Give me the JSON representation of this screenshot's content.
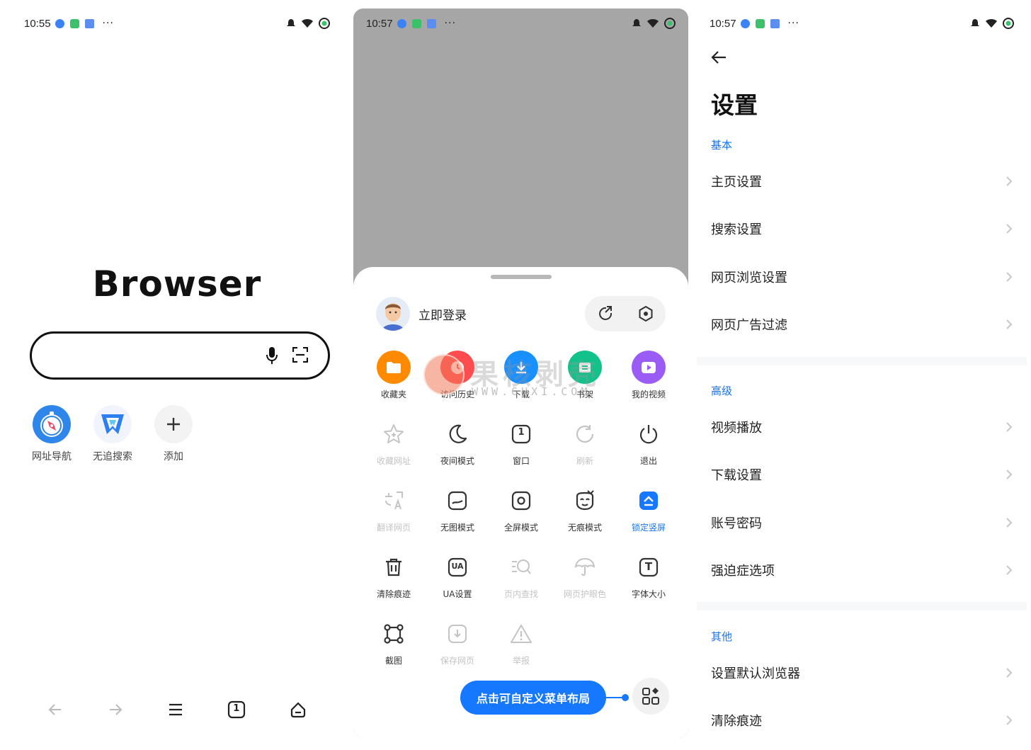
{
  "colors": {
    "accent": "#1677ff",
    "section": "#1a73e8",
    "dim": "#c4c4c4",
    "sheet_backdrop": "#a6a6a6"
  },
  "home": {
    "status_time": "10:55",
    "brand": "Browser",
    "search": {
      "placeholder": "",
      "mic_icon": "microphone-icon",
      "scan_icon": "scan-icon"
    },
    "shortcuts": [
      {
        "label": "网址导航",
        "icon": "compass-icon"
      },
      {
        "label": "无追搜索",
        "icon": "shield-icon"
      },
      {
        "label": "添加",
        "icon": "plus-icon"
      }
    ],
    "nav": [
      "back-arrow-icon",
      "forward-arrow-icon",
      "menu-icon",
      "tabs-icon",
      "home-icon"
    ],
    "tabs_count": "1"
  },
  "menu": {
    "status_time": "10:57",
    "login_label": "立即登录",
    "items": [
      {
        "label": "收藏夹",
        "icon": "folder-icon",
        "state": "colored"
      },
      {
        "label": "访问历史",
        "icon": "history-icon",
        "state": "colored"
      },
      {
        "label": "下载",
        "icon": "download-icon",
        "state": "colored"
      },
      {
        "label": "书架",
        "icon": "bookshelf-icon",
        "state": "colored"
      },
      {
        "label": "我的视频",
        "icon": "video-icon",
        "state": "colored"
      },
      {
        "label": "收藏网址",
        "icon": "star-icon",
        "state": "dim"
      },
      {
        "label": "夜间模式",
        "icon": "moon-icon",
        "state": "normal"
      },
      {
        "label": "窗口",
        "icon": "window-icon",
        "state": "normal"
      },
      {
        "label": "刷新",
        "icon": "refresh-icon",
        "state": "dim"
      },
      {
        "label": "退出",
        "icon": "power-icon",
        "state": "normal"
      },
      {
        "label": "翻译网页",
        "icon": "translate-icon",
        "state": "dim"
      },
      {
        "label": "无图模式",
        "icon": "no-image-icon",
        "state": "normal"
      },
      {
        "label": "全屏模式",
        "icon": "fullscreen-icon",
        "state": "normal"
      },
      {
        "label": "无痕模式",
        "icon": "incognito-icon",
        "state": "normal"
      },
      {
        "label": "锁定竖屏",
        "icon": "lock-portrait-icon",
        "state": "active"
      },
      {
        "label": "清除痕迹",
        "icon": "trash-icon",
        "state": "normal"
      },
      {
        "label": "UA设置",
        "icon": "ua-icon",
        "state": "normal"
      },
      {
        "label": "页内查找",
        "icon": "find-in-page-icon",
        "state": "dim"
      },
      {
        "label": "网页护眼色",
        "icon": "umbrella-icon",
        "state": "dim"
      },
      {
        "label": "字体大小",
        "icon": "font-size-icon",
        "state": "normal"
      },
      {
        "label": "截图",
        "icon": "screenshot-icon",
        "state": "normal"
      },
      {
        "label": "保存网页",
        "icon": "save-page-icon",
        "state": "dim"
      },
      {
        "label": "举报",
        "icon": "report-icon",
        "state": "dim"
      }
    ],
    "ua_text": "UA",
    "font_text": "T",
    "window_count": "1",
    "customize_label": "点击可自定义菜单布局",
    "watermark": {
      "text": "果核剥壳",
      "sub": "WWW.GHXI.COM"
    }
  },
  "settings": {
    "status_time": "10:57",
    "title": "设置",
    "sections": [
      {
        "label": "基本",
        "items": [
          "主页设置",
          "搜索设置",
          "网页浏览设置",
          "网页广告过滤"
        ]
      },
      {
        "label": "高级",
        "items": [
          "视频播放",
          "下载设置",
          "账号密码",
          "强迫症选项"
        ]
      },
      {
        "label": "其他",
        "items": [
          "设置默认浏览器",
          "清除痕迹"
        ]
      }
    ]
  }
}
